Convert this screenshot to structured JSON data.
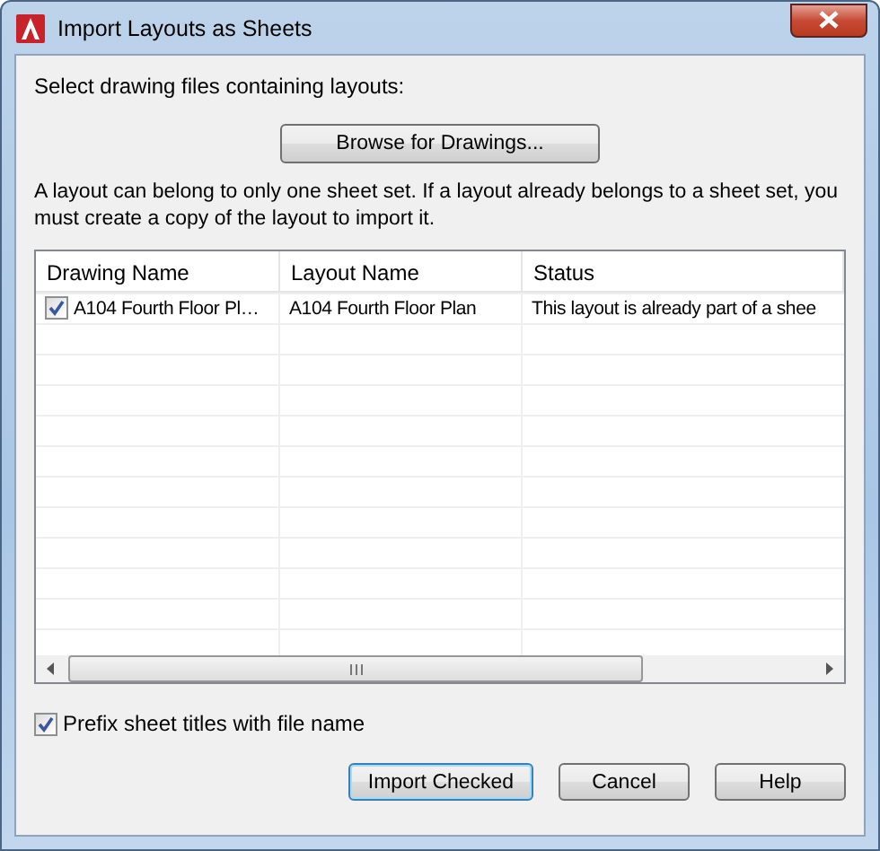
{
  "window": {
    "title": "Import Layouts as Sheets"
  },
  "select_label": "Select drawing files containing layouts:",
  "browse_button": "Browse for Drawings...",
  "note": "A layout can belong to only one sheet set. If a layout already belongs to a sheet set, you must create a copy of the layout to import it.",
  "table": {
    "columns": [
      "Drawing Name",
      "Layout Name",
      "Status"
    ],
    "rows": [
      {
        "checked": true,
        "cells": [
          "A104 Fourth Floor Pl…",
          "A104 Fourth Floor Plan",
          "This layout is already part of a shee"
        ]
      }
    ]
  },
  "prefix_option": {
    "label": "Prefix sheet titles with file name",
    "checked": true
  },
  "buttons": [
    {
      "label": "Import Checked",
      "default": true
    },
    {
      "label": "Cancel",
      "default": false
    },
    {
      "label": "Help",
      "default": false
    }
  ]
}
